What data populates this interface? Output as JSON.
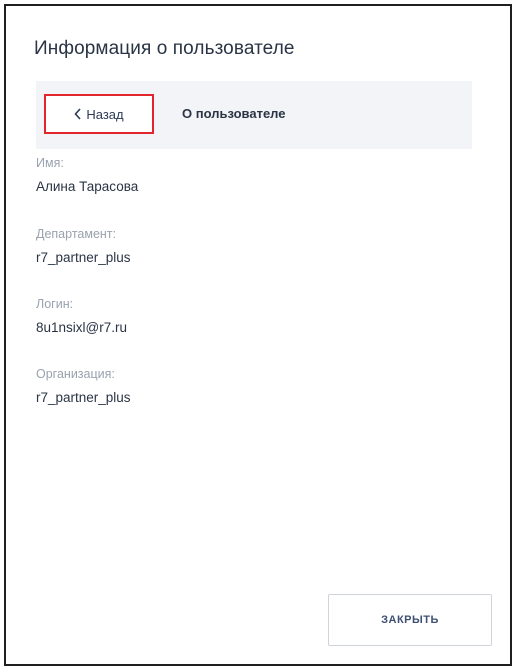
{
  "dialog": {
    "title": "Информация о пользователе"
  },
  "nav": {
    "back_label": "Назад",
    "section_title": "О пользователе"
  },
  "fields": [
    {
      "label": "Имя:",
      "value": "Алина Тарасова"
    },
    {
      "label": "Департамент:",
      "value": "r7_partner_plus"
    },
    {
      "label": "Логин:",
      "value": "8u1nsixl@r7.ru"
    },
    {
      "label": "Организация:",
      "value": "r7_partner_plus"
    }
  ],
  "actions": {
    "close_label": "ЗАКРЫТЬ"
  },
  "colors": {
    "highlight_border": "#e3262e",
    "nav_background": "#f3f4f7",
    "label_gray": "#9aa2ae",
    "text_dark": "#2a3444"
  }
}
